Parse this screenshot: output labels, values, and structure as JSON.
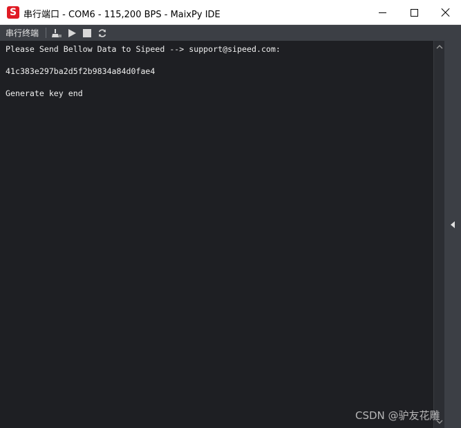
{
  "window": {
    "title": "串行端口 - COM6 - 115,200 BPS - MaixPy IDE",
    "app_icon_letter": "S"
  },
  "toolbar": {
    "title": "串行终端",
    "buttons": [
      {
        "name": "clear-icon"
      },
      {
        "name": "play-icon"
      },
      {
        "name": "stop-icon"
      },
      {
        "name": "refresh-icon"
      }
    ]
  },
  "terminal": {
    "lines": [
      "Please Send Bellow Data to Sipeed --> support@sipeed.com:",
      "",
      "41c383e297ba2d5f2b9834a84d0fae4",
      "",
      "Generate key end"
    ]
  },
  "watermark": "CSDN @驴友花雕"
}
